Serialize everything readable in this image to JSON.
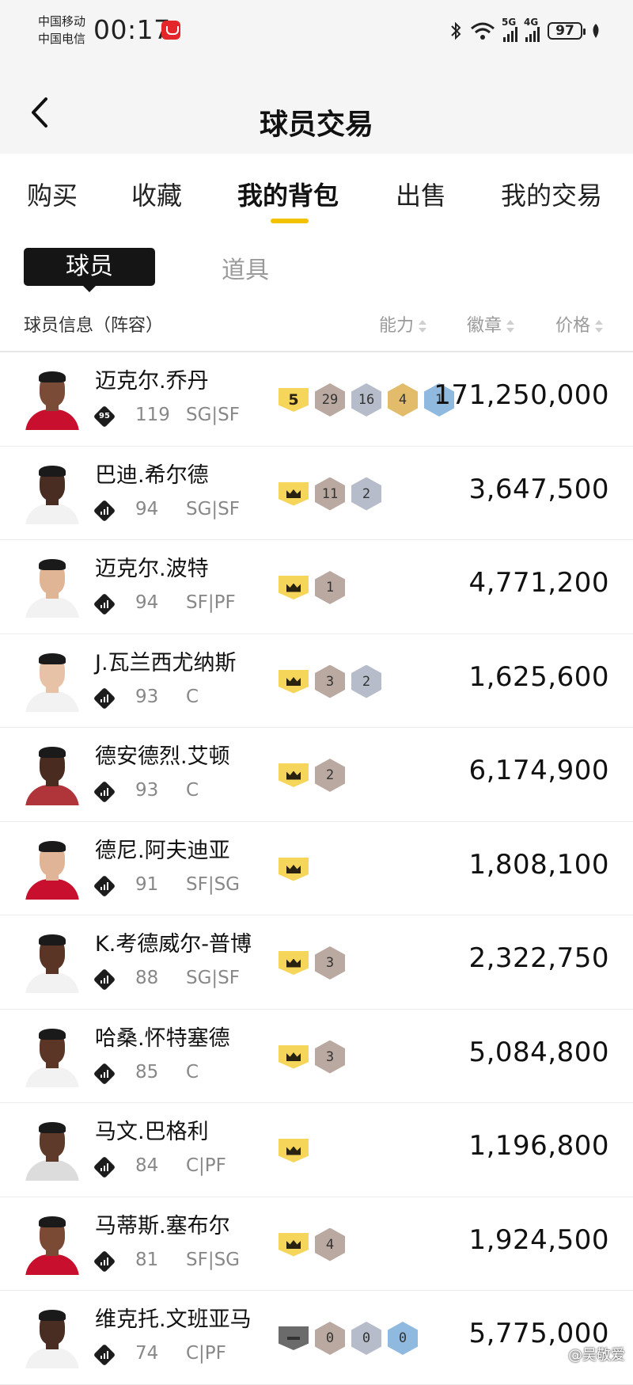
{
  "status_bar": {
    "carrier1": "中国移动",
    "carrier2": "中国电信",
    "time": "00:17",
    "net1": "5G",
    "net2": "4G",
    "battery": "97"
  },
  "header": {
    "title": "球员交易"
  },
  "tabs": [
    {
      "label": "购买"
    },
    {
      "label": "收藏"
    },
    {
      "label": "我的背包",
      "active": true
    },
    {
      "label": "出售"
    },
    {
      "label": "我的交易"
    }
  ],
  "subtabs": {
    "player": "球员",
    "item": "道具"
  },
  "columns": {
    "info": "球员信息（阵容）",
    "ability": "能力",
    "badges": "徽章",
    "price": "价格"
  },
  "players": [
    {
      "name": "迈克尔.乔丹",
      "tier": "95",
      "ovr": "119",
      "pos": "SG|SF",
      "skin": "#7a4b37",
      "jersey": "#c8102e",
      "badges": [
        {
          "type": "shield",
          "label": "5"
        },
        {
          "type": "bronze",
          "label": "29"
        },
        {
          "type": "silver",
          "label": "16"
        },
        {
          "type": "gold",
          "label": "4"
        },
        {
          "type": "blue",
          "label": "1"
        }
      ],
      "price": "171,250,000"
    },
    {
      "name": "巴迪.希尔德",
      "tier": "",
      "ovr": "94",
      "pos": "SG|SF",
      "skin": "#4a2d22",
      "jersey": "#f2f2f2",
      "badges": [
        {
          "type": "crown"
        },
        {
          "type": "bronze",
          "label": "11"
        },
        {
          "type": "silver",
          "label": "2"
        }
      ],
      "price": "3,647,500"
    },
    {
      "name": "迈克尔.波特",
      "tier": "",
      "ovr": "94",
      "pos": "SF|PF",
      "skin": "#e0b596",
      "jersey": "#f2f2f2",
      "badges": [
        {
          "type": "crown"
        },
        {
          "type": "bronze",
          "label": "1"
        }
      ],
      "price": "4,771,200"
    },
    {
      "name": "J.瓦兰西尤纳斯",
      "tier": "",
      "ovr": "93",
      "pos": "C",
      "skin": "#e8c2a7",
      "jersey": "#f2f2f2",
      "badges": [
        {
          "type": "crown"
        },
        {
          "type": "bronze",
          "label": "3"
        },
        {
          "type": "silver",
          "label": "2"
        }
      ],
      "price": "1,625,600"
    },
    {
      "name": "德安德烈.艾顿",
      "tier": "",
      "ovr": "93",
      "pos": "C",
      "skin": "#4a2b20",
      "jersey": "#b0353a",
      "badges": [
        {
          "type": "crown"
        },
        {
          "type": "bronze",
          "label": "2"
        }
      ],
      "price": "6,174,900"
    },
    {
      "name": "德尼.阿夫迪亚",
      "tier": "",
      "ovr": "91",
      "pos": "SF|SG",
      "skin": "#dfb497",
      "jersey": "#c8102e",
      "badges": [
        {
          "type": "crown"
        }
      ],
      "price": "1,808,100"
    },
    {
      "name": "K.考德威尔-普博",
      "tier": "",
      "ovr": "88",
      "pos": "SG|SF",
      "skin": "#5a3424",
      "jersey": "#f2f2f2",
      "badges": [
        {
          "type": "crown"
        },
        {
          "type": "bronze",
          "label": "3"
        }
      ],
      "price": "2,322,750"
    },
    {
      "name": "哈桑.怀特塞德",
      "tier": "",
      "ovr": "85",
      "pos": "C",
      "skin": "#5b3526",
      "jersey": "#f2f2f2",
      "badges": [
        {
          "type": "crown"
        },
        {
          "type": "bronze",
          "label": "3"
        }
      ],
      "price": "5,084,800"
    },
    {
      "name": "马文.巴格利",
      "tier": "",
      "ovr": "84",
      "pos": "C|PF",
      "skin": "#5d3a29",
      "jersey": "#dcdcdc",
      "badges": [
        {
          "type": "crown"
        }
      ],
      "price": "1,196,800"
    },
    {
      "name": "马蒂斯.塞布尔",
      "tier": "",
      "ovr": "81",
      "pos": "SF|SG",
      "skin": "#7a4a34",
      "jersey": "#c8102e",
      "badges": [
        {
          "type": "crown"
        },
        {
          "type": "bronze",
          "label": "4"
        }
      ],
      "price": "1,924,500"
    },
    {
      "name": "维克托.文班亚马",
      "tier": "",
      "ovr": "74",
      "pos": "C|PF",
      "skin": "#4a2d22",
      "jersey": "#f2f2f2",
      "badges": [
        {
          "type": "grayshield"
        },
        {
          "type": "bronze",
          "label": "0"
        },
        {
          "type": "silver",
          "label": "0"
        },
        {
          "type": "blue",
          "label": "0"
        }
      ],
      "price": "5,775,000"
    }
  ],
  "watermark": "@吴敬爱",
  "colors": {
    "accent": "#f2c200",
    "header_bg": "#f5f5f5",
    "active_subtab": "#151515"
  }
}
